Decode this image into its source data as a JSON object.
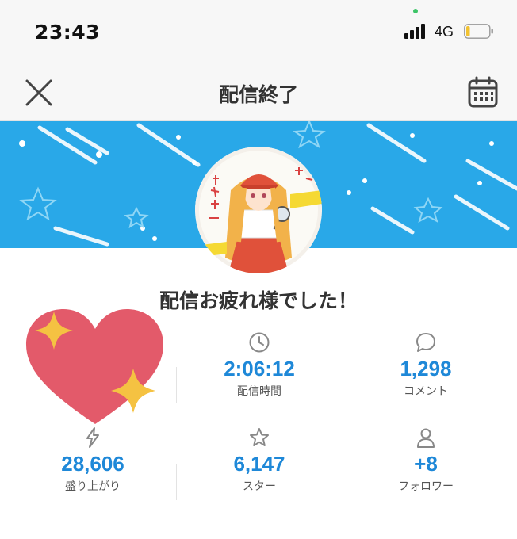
{
  "status_bar": {
    "time": "23:43",
    "network": "4G"
  },
  "header": {
    "title": "配信終了",
    "close_icon": "close-icon",
    "calendar_icon": "calendar-icon"
  },
  "greeting": "配信お疲れ様でした！",
  "stats": [
    {
      "icon": "lightning-icon",
      "value": "28,606",
      "label": "盛り上がり"
    },
    {
      "icon": "clock-icon",
      "value": "2:06:12",
      "label": "配信時間"
    },
    {
      "icon": "comment-icon",
      "value": "1,298",
      "label": "コメント"
    },
    {
      "icon": "star-icon",
      "value": "6,147",
      "label": "スター"
    },
    {
      "icon": "person-icon",
      "value": "+8",
      "label": "フォロワー"
    }
  ],
  "colors": {
    "banner": "#29a8e8",
    "stat_value": "#1e88d8",
    "heart": "#e35a6a",
    "sparkle": "#f5c242"
  }
}
